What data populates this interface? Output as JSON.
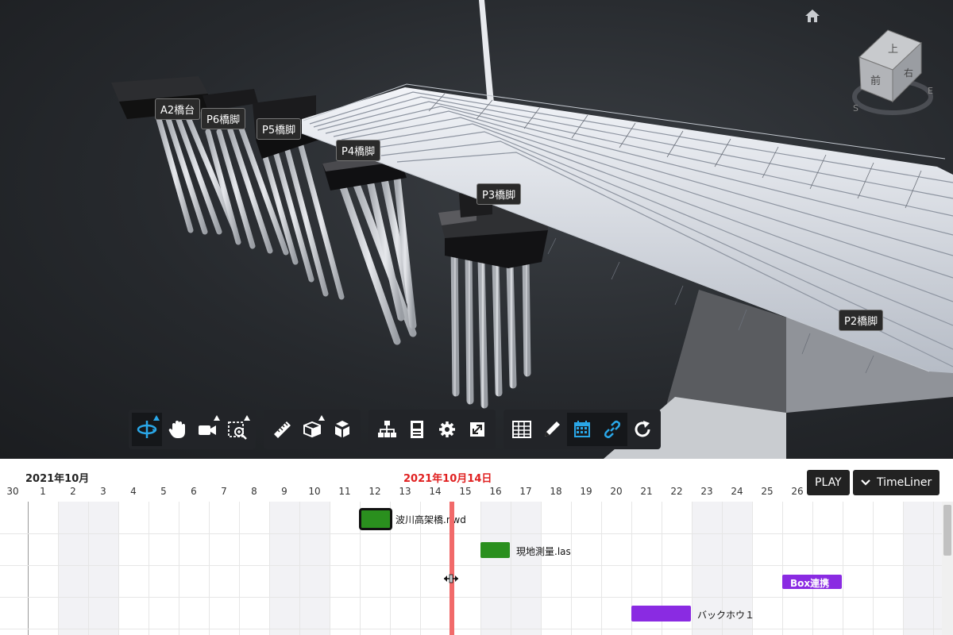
{
  "viewer": {
    "labels": {
      "a2": "A2橋台",
      "p6": "P6橋脚",
      "p5": "P5橋脚",
      "p4": "P4橋脚",
      "p3": "P3橋脚",
      "p2": "P2橋脚"
    },
    "viewcube": {
      "top": "上",
      "front": "前",
      "right": "右",
      "compass_s": "S",
      "compass_e": "E"
    }
  },
  "toolbar": {
    "groups": [
      [
        "orbit-icon",
        "pan-icon",
        "camera-icon",
        "zoom-window-icon"
      ],
      [
        "measure-icon",
        "section-icon",
        "explode-icon"
      ],
      [
        "model-browser-icon",
        "properties-icon",
        "settings-icon",
        "fullscreen-icon"
      ],
      [
        "grid-icon",
        "markup-icon",
        "calendar-icon",
        "link-icon",
        "refresh-icon"
      ]
    ],
    "active": [
      "orbit-icon",
      "calendar-icon",
      "link-icon"
    ],
    "accent_color": "#2aa7e8"
  },
  "timeline": {
    "month_label": "2021年10月",
    "current_date_label": "2021年10月14日",
    "days": [
      "30",
      "1",
      "2",
      "3",
      "4",
      "5",
      "6",
      "7",
      "8",
      "9",
      "10",
      "11",
      "12",
      "13",
      "14",
      "15",
      "16",
      "17",
      "18",
      "19",
      "20",
      "21",
      "22",
      "23",
      "24",
      "25",
      "26"
    ],
    "play_label": "PLAY",
    "timeliner_label": "TimeLiner",
    "items": [
      {
        "label": "波川高架橋.nwd",
        "color": "#2a8f1e",
        "selected": true
      },
      {
        "label": "現地測量.las",
        "color": "#2a8f1e",
        "selected": false
      },
      {
        "label": "Box連携",
        "color": "#8a2be2",
        "selected": false
      },
      {
        "label": "バックホウ１",
        "color": "#8a2be2",
        "selected": false
      }
    ],
    "today_color": "#f16a6a"
  }
}
